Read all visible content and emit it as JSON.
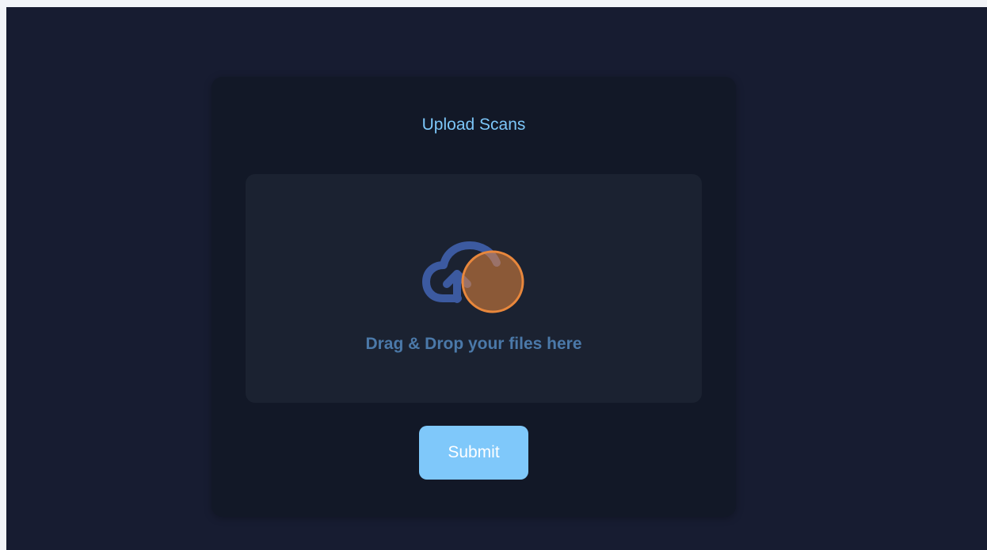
{
  "upload_card": {
    "title": "Upload Scans",
    "dropzone": {
      "icon": "cloud-upload-icon",
      "text": "Drag & Drop your files here"
    },
    "submit_label": "Submit"
  },
  "colors": {
    "page_background": "#171c31",
    "card_background": "#121827",
    "dropzone_background": "#1b2231",
    "title_text": "#7cc6f8",
    "dropzone_text": "#4b79a9",
    "icon_blue": "#3c5aa0",
    "icon_orange": "#e8873c",
    "submit_background": "#7fc8fa"
  }
}
